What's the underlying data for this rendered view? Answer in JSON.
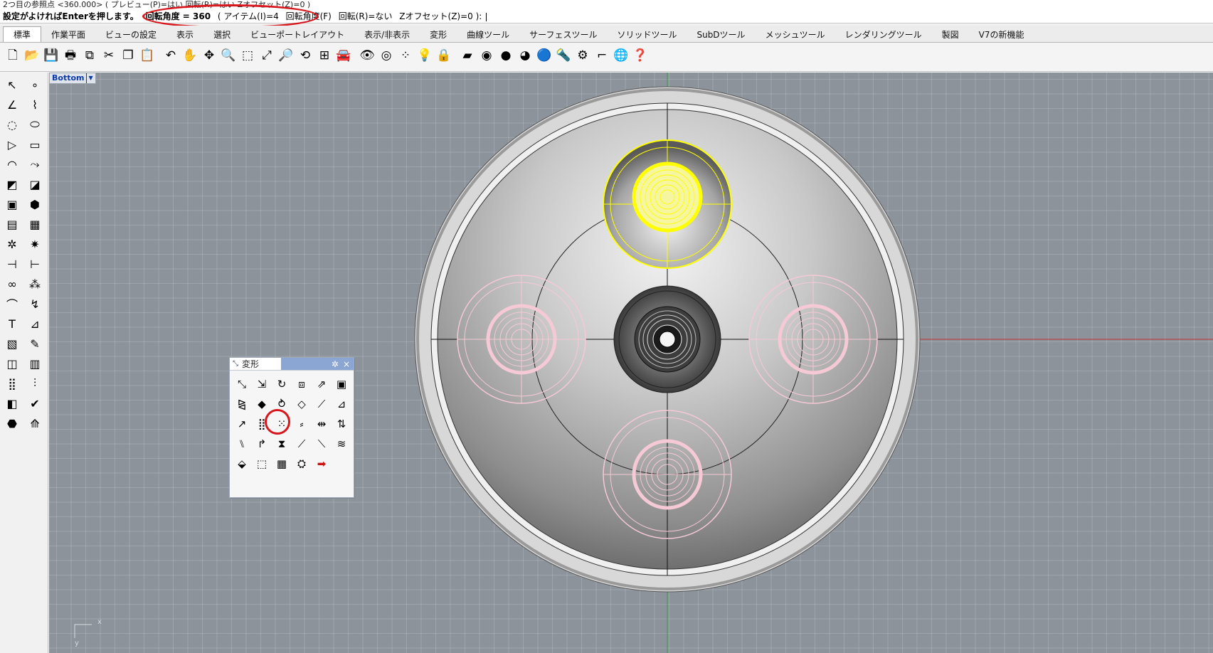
{
  "command": {
    "history_line": "2つ目の参照点 <360.000> ( プレビュー(P)=はい  回転(R)=はい  Zオフセット(Z)=0 )",
    "prompt_label": "設定がよければEnterを押します。",
    "prompt_emphasis": "回転角度 = 360",
    "option_items": "( アイテム(I)=4",
    "option_fill_angle": "回転角度(F)",
    "option_rotate": "回転(R)=ない",
    "option_zoffset": "Zオフセット(Z)=0 ):"
  },
  "tabs": [
    {
      "label": "標準",
      "active": true
    },
    {
      "label": "作業平面"
    },
    {
      "label": "ビューの設定"
    },
    {
      "label": "表示"
    },
    {
      "label": "選択"
    },
    {
      "label": "ビューポートレイアウト"
    },
    {
      "label": "表示/非表示"
    },
    {
      "label": "変形"
    },
    {
      "label": "曲線ツール"
    },
    {
      "label": "サーフェスツール"
    },
    {
      "label": "ソリッドツール"
    },
    {
      "label": "SubDツール"
    },
    {
      "label": "メッシュツール"
    },
    {
      "label": "レンダリングツール"
    },
    {
      "label": "製図"
    },
    {
      "label": "V7の新機能"
    }
  ],
  "toolbar_icons": [
    {
      "name": "new-file-icon",
      "glyph": "🗋"
    },
    {
      "name": "open-folder-icon",
      "glyph": "📂"
    },
    {
      "name": "save-icon",
      "glyph": "💾"
    },
    {
      "name": "print-icon",
      "glyph": "🖶"
    },
    {
      "name": "export-icon",
      "glyph": "⧉"
    },
    {
      "name": "cut-icon",
      "glyph": "✂"
    },
    {
      "name": "copy-icon",
      "glyph": "❐"
    },
    {
      "name": "paste-icon",
      "glyph": "📋"
    },
    {
      "name": "undo-icon",
      "glyph": "↶"
    },
    {
      "name": "pan-hand-icon",
      "glyph": "✋"
    },
    {
      "name": "rotate-view-icon",
      "glyph": "✥"
    },
    {
      "name": "zoom-dynamic-icon",
      "glyph": "🔍"
    },
    {
      "name": "zoom-window-icon",
      "glyph": "⬚"
    },
    {
      "name": "zoom-extents-icon",
      "glyph": "⤢"
    },
    {
      "name": "zoom-selected-icon",
      "glyph": "🔎"
    },
    {
      "name": "undo-view-icon",
      "glyph": "⟲"
    },
    {
      "name": "viewport-layout-icon",
      "glyph": "⊞"
    },
    {
      "name": "car-icon",
      "glyph": "🚘"
    },
    {
      "name": "hide-eye-icon",
      "glyph": "👁"
    },
    {
      "name": "osnap-target-icon",
      "glyph": "◎"
    },
    {
      "name": "point-edit-icon",
      "glyph": "⁘"
    },
    {
      "name": "light-bulb-icon",
      "glyph": "💡"
    },
    {
      "name": "lock-icon",
      "glyph": "🔒"
    },
    {
      "name": "layer-icon",
      "glyph": "▰"
    },
    {
      "name": "color-wheel-icon",
      "glyph": "◉"
    },
    {
      "name": "shaded-sphere-icon",
      "glyph": "●"
    },
    {
      "name": "rendered-sphere-icon",
      "glyph": "◕"
    },
    {
      "name": "render-blue-sphere-icon",
      "glyph": "🔵"
    },
    {
      "name": "spotlight-icon",
      "glyph": "🔦"
    },
    {
      "name": "options-gear-icon",
      "glyph": "⚙"
    },
    {
      "name": "dimension-icon",
      "glyph": "⌐"
    },
    {
      "name": "globe-icon",
      "glyph": "🌐"
    },
    {
      "name": "help-icon",
      "glyph": "❓"
    }
  ],
  "left_tools": [
    {
      "name": "select-arrow-icon",
      "glyph": "↖"
    },
    {
      "name": "point-icon",
      "glyph": "∘"
    },
    {
      "name": "polyline-icon",
      "glyph": "∠"
    },
    {
      "name": "curve-cv-icon",
      "glyph": "⌇"
    },
    {
      "name": "circle-icon",
      "glyph": "◌"
    },
    {
      "name": "ellipse-icon",
      "glyph": "⬭"
    },
    {
      "name": "polygon-icon",
      "glyph": "▷"
    },
    {
      "name": "rectangle-icon",
      "glyph": "▭"
    },
    {
      "name": "arc-icon",
      "glyph": "◠"
    },
    {
      "name": "curve-fillet-icon",
      "glyph": "⤳"
    },
    {
      "name": "surface-corner-icon",
      "glyph": "◩"
    },
    {
      "name": "surface-extrude-icon",
      "glyph": "◪"
    },
    {
      "name": "box-solid-icon",
      "glyph": "▣"
    },
    {
      "name": "boolean-union-icon",
      "glyph": "⬢"
    },
    {
      "name": "mesh-plane-icon",
      "glyph": "▤"
    },
    {
      "name": "mesh-surface-icon",
      "glyph": "▦"
    },
    {
      "name": "gear-group-icon",
      "glyph": "✲"
    },
    {
      "name": "explode-icon",
      "glyph": "✷"
    },
    {
      "name": "trim-icon",
      "glyph": "⊣"
    },
    {
      "name": "split-icon",
      "glyph": "⊢"
    },
    {
      "name": "join-icon",
      "glyph": "∞"
    },
    {
      "name": "group-icon",
      "glyph": "⁂"
    },
    {
      "name": "edit-point-icon",
      "glyph": "⌒"
    },
    {
      "name": "rebuild-icon",
      "glyph": "↯"
    },
    {
      "name": "text-tool-icon",
      "glyph": "T"
    },
    {
      "name": "dimension-tool-icon",
      "glyph": "⊿"
    },
    {
      "name": "block-icon",
      "glyph": "▧"
    },
    {
      "name": "leader-icon",
      "glyph": "✎"
    },
    {
      "name": "named-view-icon",
      "glyph": "◫"
    },
    {
      "name": "cplane-icon",
      "glyph": "▥"
    },
    {
      "name": "grid-array-icon",
      "glyph": "⣿"
    },
    {
      "name": "array-linear-icon",
      "glyph": "⫶"
    },
    {
      "name": "analyze-icon",
      "glyph": "◧"
    },
    {
      "name": "check-icon",
      "glyph": "✔"
    },
    {
      "name": "render-mesh-icon",
      "glyph": "⬣"
    },
    {
      "name": "mirror-tool-icon",
      "glyph": "⟰"
    }
  ],
  "viewport": {
    "label": "Bottom",
    "axis_x": "x",
    "axis_y": "y"
  },
  "transform_panel": {
    "title": "変形",
    "settings_glyph": "✲",
    "close_glyph": "×",
    "tools": [
      {
        "name": "move-icon",
        "glyph": "⤡"
      },
      {
        "name": "copy-icon",
        "glyph": "⇲"
      },
      {
        "name": "rotate-icon",
        "glyph": "↻"
      },
      {
        "name": "scale-icon",
        "glyph": "⧈"
      },
      {
        "name": "orient-icon",
        "glyph": "⇗"
      },
      {
        "name": "box-edit-icon",
        "glyph": "▣"
      },
      {
        "name": "mirror-icon",
        "glyph": "⧎"
      },
      {
        "name": "align-icon",
        "glyph": "◆"
      },
      {
        "name": "twist-icon",
        "glyph": "⥁"
      },
      {
        "name": "point-transform-icon",
        "glyph": "◇"
      },
      {
        "name": "taper-icon",
        "glyph": "⟋"
      },
      {
        "name": "shear-icon",
        "glyph": "⊿"
      },
      {
        "name": "set-points-icon",
        "glyph": "↗"
      },
      {
        "name": "array-grid-icon",
        "glyph": "⣿"
      },
      {
        "name": "array-polar-icon",
        "glyph": "⁙"
      },
      {
        "name": "array-curve-icon",
        "glyph": "⸗"
      },
      {
        "name": "array-linear-icon",
        "glyph": "⇹"
      },
      {
        "name": "array-along-icon",
        "glyph": "⇅"
      },
      {
        "name": "bend-icon",
        "glyph": "⑊"
      },
      {
        "name": "flow-icon",
        "glyph": "↱"
      },
      {
        "name": "splop-icon",
        "glyph": "⧗"
      },
      {
        "name": "stretch-icon",
        "glyph": "⟋"
      },
      {
        "name": "smash-icon",
        "glyph": "⟍"
      },
      {
        "name": "wave-icon",
        "glyph": "≋"
      },
      {
        "name": "cage-icon",
        "glyph": "⬙"
      },
      {
        "name": "morph-icon",
        "glyph": "⬚"
      },
      {
        "name": "grid-surface-icon",
        "glyph": "▦"
      },
      {
        "name": "sphere-morph-icon",
        "glyph": "⛭"
      },
      {
        "name": "arrow-next-icon",
        "glyph": "➡"
      }
    ]
  },
  "colors": {
    "highlight_red": "#d8171c",
    "selected_yellow": "#ffff00",
    "preview_pink": "#f5c9d5",
    "x_axis": "#c03030",
    "y_axis": "#2aa03a",
    "grid_bg": "#8d939b"
  }
}
